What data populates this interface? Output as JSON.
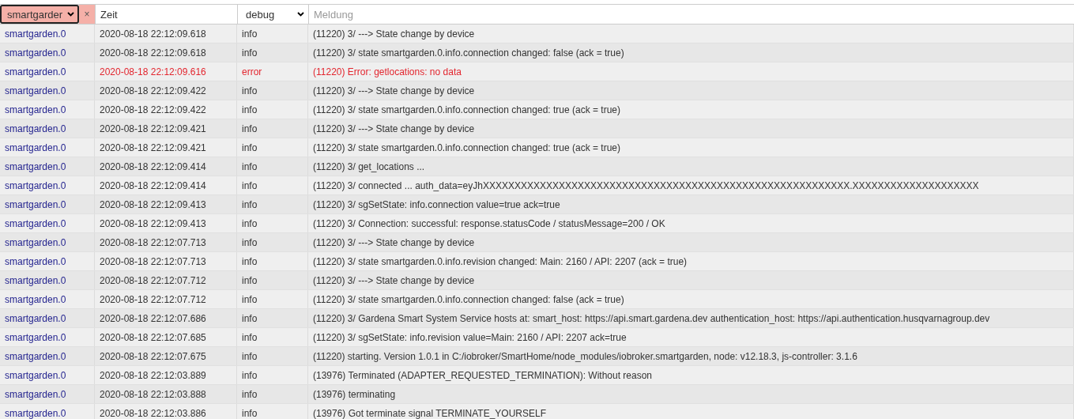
{
  "filters": {
    "source": "smartgarder",
    "clear": "×",
    "time": "Zeit",
    "severity": "debug",
    "message_placeholder": "Meldung"
  },
  "rows": [
    {
      "kind": "info",
      "source": "smartgarden.0",
      "time": "2020-08-18 22:12:09.618",
      "severity": "info",
      "message": "(11220) 3/ ---> State change by device"
    },
    {
      "kind": "info",
      "source": "smartgarden.0",
      "time": "2020-08-18 22:12:09.618",
      "severity": "info",
      "message": "(11220) 3/ state smartgarden.0.info.connection changed: false (ack = true)"
    },
    {
      "kind": "error",
      "source": "smartgarden.0",
      "time": "2020-08-18 22:12:09.616",
      "severity": "error",
      "message": "(11220) Error: getlocations: no data"
    },
    {
      "kind": "info",
      "source": "smartgarden.0",
      "time": "2020-08-18 22:12:09.422",
      "severity": "info",
      "message": "(11220) 3/ ---> State change by device"
    },
    {
      "kind": "info",
      "source": "smartgarden.0",
      "time": "2020-08-18 22:12:09.422",
      "severity": "info",
      "message": "(11220) 3/ state smartgarden.0.info.connection changed: true (ack = true)"
    },
    {
      "kind": "info",
      "source": "smartgarden.0",
      "time": "2020-08-18 22:12:09.421",
      "severity": "info",
      "message": "(11220) 3/ ---> State change by device"
    },
    {
      "kind": "info",
      "source": "smartgarden.0",
      "time": "2020-08-18 22:12:09.421",
      "severity": "info",
      "message": "(11220) 3/ state smartgarden.0.info.connection changed: true (ack = true)"
    },
    {
      "kind": "info",
      "source": "smartgarden.0",
      "time": "2020-08-18 22:12:09.414",
      "severity": "info",
      "message": "(11220) 3/ get_locations ..."
    },
    {
      "kind": "info",
      "source": "smartgarden.0",
      "time": "2020-08-18 22:12:09.414",
      "severity": "info",
      "message": "(11220) 3/ connected ... auth_data=eyJhXXXXXXXXXXXXXXXXXXXXXXXXXXXXXXXXXXXXXXXXXXXXXXXXXXXXXXXXXX.XXXXXXXXXXXXXXXXXXXX"
    },
    {
      "kind": "info",
      "source": "smartgarden.0",
      "time": "2020-08-18 22:12:09.413",
      "severity": "info",
      "message": "(11220) 3/ sgSetState: info.connection value=true ack=true"
    },
    {
      "kind": "info",
      "source": "smartgarden.0",
      "time": "2020-08-18 22:12:09.413",
      "severity": "info",
      "message": "(11220) 3/ Connection: successful: response.statusCode / statusMessage=200 / OK"
    },
    {
      "kind": "info",
      "source": "smartgarden.0",
      "time": "2020-08-18 22:12:07.713",
      "severity": "info",
      "message": "(11220) 3/ ---> State change by device"
    },
    {
      "kind": "info",
      "source": "smartgarden.0",
      "time": "2020-08-18 22:12:07.713",
      "severity": "info",
      "message": "(11220) 3/ state smartgarden.0.info.revision changed: Main: 2160 / API: 2207 (ack = true)"
    },
    {
      "kind": "info",
      "source": "smartgarden.0",
      "time": "2020-08-18 22:12:07.712",
      "severity": "info",
      "message": "(11220) 3/ ---> State change by device"
    },
    {
      "kind": "info",
      "source": "smartgarden.0",
      "time": "2020-08-18 22:12:07.712",
      "severity": "info",
      "message": "(11220) 3/ state smartgarden.0.info.connection changed: false (ack = true)"
    },
    {
      "kind": "info",
      "source": "smartgarden.0",
      "time": "2020-08-18 22:12:07.686",
      "severity": "info",
      "message": "(11220) 3/ Gardena Smart System Service hosts at: smart_host: https://api.smart.gardena.dev authentication_host: https://api.authentication.husqvarnagroup.dev"
    },
    {
      "kind": "info",
      "source": "smartgarden.0",
      "time": "2020-08-18 22:12:07.685",
      "severity": "info",
      "message": "(11220) 3/ sgSetState: info.revision value=Main: 2160 / API: 2207 ack=true"
    },
    {
      "kind": "info",
      "source": "smartgarden.0",
      "time": "2020-08-18 22:12:07.675",
      "severity": "info",
      "message": "(11220) starting. Version 1.0.1 in C:/iobroker/SmartHome/node_modules/iobroker.smartgarden, node: v12.18.3, js-controller: 3.1.6"
    },
    {
      "kind": "info",
      "source": "smartgarden.0",
      "time": "2020-08-18 22:12:03.889",
      "severity": "info",
      "message": "(13976) Terminated (ADAPTER_REQUESTED_TERMINATION): Without reason"
    },
    {
      "kind": "info",
      "source": "smartgarden.0",
      "time": "2020-08-18 22:12:03.888",
      "severity": "info",
      "message": "(13976) terminating"
    },
    {
      "kind": "info",
      "source": "smartgarden.0",
      "time": "2020-08-18 22:12:03.886",
      "severity": "info",
      "message": "(13976) Got terminate signal TERMINATE_YOURSELF"
    }
  ]
}
